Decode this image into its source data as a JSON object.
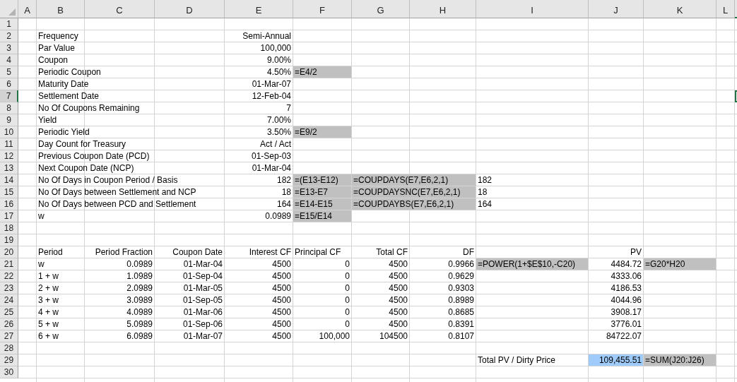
{
  "columns": [
    {
      "label": "A"
    },
    {
      "label": "B"
    },
    {
      "label": "C"
    },
    {
      "label": "D"
    },
    {
      "label": "E"
    },
    {
      "label": "F"
    },
    {
      "label": "G"
    },
    {
      "label": "H"
    },
    {
      "label": "I"
    },
    {
      "label": "J"
    },
    {
      "label": "K"
    },
    {
      "label": "L"
    }
  ],
  "rows": [
    {
      "number": "1",
      "selected": false
    },
    {
      "number": "2",
      "selected": false,
      "cells": {
        "B": {
          "kind": "label",
          "text": "Frequency"
        },
        "E": {
          "kind": "value",
          "text": "Semi-Annual"
        }
      }
    },
    {
      "number": "3",
      "selected": false,
      "cells": {
        "B": {
          "kind": "label",
          "text": "Par Value"
        },
        "E": {
          "kind": "value",
          "text": "100,000"
        }
      }
    },
    {
      "number": "4",
      "selected": false,
      "cells": {
        "B": {
          "kind": "label",
          "text": "Coupon"
        },
        "E": {
          "kind": "value",
          "text": "9.00%"
        }
      }
    },
    {
      "number": "5",
      "selected": false,
      "cells": {
        "B": {
          "kind": "label",
          "text": "Periodic Coupon"
        },
        "E": {
          "kind": "value",
          "text": "4.50%"
        },
        "F": {
          "kind": "formula",
          "text": "=E4/2"
        }
      }
    },
    {
      "number": "6",
      "selected": false,
      "cells": {
        "B": {
          "kind": "label",
          "text": "Maturity Date"
        },
        "E": {
          "kind": "value",
          "text": "01-Mar-07"
        }
      }
    },
    {
      "number": "7",
      "selected": true,
      "cells": {
        "B": {
          "kind": "label",
          "text": "Settlement Date"
        },
        "E": {
          "kind": "value",
          "text": "12-Feb-04"
        }
      }
    },
    {
      "number": "8",
      "selected": false,
      "cells": {
        "B": {
          "kind": "label",
          "text": "No Of Coupons Remaining"
        },
        "E": {
          "kind": "value",
          "text": "7"
        }
      }
    },
    {
      "number": "9",
      "selected": false,
      "cells": {
        "B": {
          "kind": "label",
          "text": "Yield"
        },
        "E": {
          "kind": "value",
          "text": "7.00%"
        }
      }
    },
    {
      "number": "10",
      "selected": false,
      "cells": {
        "B": {
          "kind": "label",
          "text": "Periodic Yield"
        },
        "E": {
          "kind": "value",
          "text": "3.50%"
        },
        "F": {
          "kind": "formula",
          "text": "=E9/2"
        }
      }
    },
    {
      "number": "11",
      "selected": false,
      "cells": {
        "B": {
          "kind": "label",
          "text": "Day Count for Treasury"
        },
        "E": {
          "kind": "value",
          "text": "Act / Act"
        }
      }
    },
    {
      "number": "12",
      "selected": false,
      "cells": {
        "B": {
          "kind": "label",
          "text": "Previous Coupon Date (PCD)"
        },
        "E": {
          "kind": "value",
          "text": "01-Sep-03"
        }
      }
    },
    {
      "number": "13",
      "selected": false,
      "cells": {
        "B": {
          "kind": "label",
          "text": "Next Coupon Date (NCP)"
        },
        "E": {
          "kind": "value",
          "text": "01-Mar-04"
        }
      }
    },
    {
      "number": "14",
      "selected": false,
      "cells": {
        "B": {
          "kind": "label",
          "text": "No Of Days in Coupon Period / Basis"
        },
        "E": {
          "kind": "value",
          "text": "182"
        },
        "F": {
          "kind": "formula",
          "text": "=(E13-E12)"
        },
        "G": {
          "kind": "formula-wide",
          "text": "=COUPDAYS(E7,E6,2,1)"
        },
        "I": {
          "kind": "label",
          "text": "182"
        }
      }
    },
    {
      "number": "15",
      "selected": false,
      "cells": {
        "B": {
          "kind": "label",
          "text": "No Of Days between Settlement and NCP"
        },
        "E": {
          "kind": "value",
          "text": "18"
        },
        "F": {
          "kind": "formula",
          "text": "=E13-E7"
        },
        "G": {
          "kind": "formula-wide",
          "text": "=COUPDAYSNC(E7,E6,2,1)"
        },
        "I": {
          "kind": "label",
          "text": "18"
        }
      }
    },
    {
      "number": "16",
      "selected": false,
      "cells": {
        "B": {
          "kind": "label",
          "text": "No Of Days between PCD and Settlement"
        },
        "E": {
          "kind": "value",
          "text": "164"
        },
        "F": {
          "kind": "formula",
          "text": "=E14-E15"
        },
        "G": {
          "kind": "formula-wide",
          "text": "=COUPDAYBS(E7,E6,2,1)"
        },
        "I": {
          "kind": "label",
          "text": "164"
        }
      }
    },
    {
      "number": "17",
      "selected": false,
      "cells": {
        "B": {
          "kind": "label",
          "text": "w"
        },
        "E": {
          "kind": "value",
          "text": "0.0989"
        },
        "F": {
          "kind": "formula",
          "text": "=E15/E14"
        }
      }
    },
    {
      "number": "18",
      "selected": false
    },
    {
      "number": "19",
      "selected": false
    },
    {
      "number": "20",
      "selected": false,
      "cells": {
        "B": {
          "kind": "label",
          "text": "Period"
        },
        "C": {
          "kind": "value",
          "text": "Period Fraction"
        },
        "D": {
          "kind": "value",
          "text": "Coupon Date"
        },
        "E": {
          "kind": "value",
          "text": "Interest CF"
        },
        "F": {
          "kind": "label",
          "text": "Principal CF"
        },
        "G": {
          "kind": "value",
          "text": "Total CF"
        },
        "H": {
          "kind": "value",
          "text": "DF"
        },
        "J": {
          "kind": "value",
          "text": "PV"
        }
      }
    },
    {
      "number": "21",
      "selected": false,
      "cells": {
        "B": {
          "kind": "label",
          "text": "w"
        },
        "C": {
          "kind": "value",
          "text": "0.0989"
        },
        "D": {
          "kind": "value",
          "text": "01-Mar-04"
        },
        "E": {
          "kind": "value",
          "text": "4500"
        },
        "F": {
          "kind": "value",
          "text": "0"
        },
        "G": {
          "kind": "value",
          "text": "4500"
        },
        "H": {
          "kind": "value",
          "text": "0.9966"
        },
        "I": {
          "kind": "formula",
          "text": "=POWER(1+$E$10,-C20)"
        },
        "J": {
          "kind": "value",
          "text": "4484.72"
        },
        "K": {
          "kind": "formula",
          "text": "=G20*H20"
        }
      }
    },
    {
      "number": "22",
      "selected": false,
      "cells": {
        "B": {
          "kind": "label",
          "text": "1 + w"
        },
        "C": {
          "kind": "value",
          "text": "1.0989"
        },
        "D": {
          "kind": "value",
          "text": "01-Sep-04"
        },
        "E": {
          "kind": "value",
          "text": "4500"
        },
        "F": {
          "kind": "value",
          "text": "0"
        },
        "G": {
          "kind": "value",
          "text": "4500"
        },
        "H": {
          "kind": "value",
          "text": "0.9629"
        },
        "J": {
          "kind": "value",
          "text": "4333.06"
        }
      }
    },
    {
      "number": "23",
      "selected": false,
      "cells": {
        "B": {
          "kind": "label",
          "text": "2 + w"
        },
        "C": {
          "kind": "value",
          "text": "2.0989"
        },
        "D": {
          "kind": "value",
          "text": "01-Mar-05"
        },
        "E": {
          "kind": "value",
          "text": "4500"
        },
        "F": {
          "kind": "value",
          "text": "0"
        },
        "G": {
          "kind": "value",
          "text": "4500"
        },
        "H": {
          "kind": "value",
          "text": "0.9303"
        },
        "J": {
          "kind": "value",
          "text": "4186.53"
        }
      }
    },
    {
      "number": "24",
      "selected": false,
      "cells": {
        "B": {
          "kind": "label",
          "text": "3 + w"
        },
        "C": {
          "kind": "value",
          "text": "3.0989"
        },
        "D": {
          "kind": "value",
          "text": "01-Sep-05"
        },
        "E": {
          "kind": "value",
          "text": "4500"
        },
        "F": {
          "kind": "value",
          "text": "0"
        },
        "G": {
          "kind": "value",
          "text": "4500"
        },
        "H": {
          "kind": "value",
          "text": "0.8989"
        },
        "J": {
          "kind": "value",
          "text": "4044.96"
        }
      }
    },
    {
      "number": "25",
      "selected": false,
      "cells": {
        "B": {
          "kind": "label",
          "text": "4 + w"
        },
        "C": {
          "kind": "value",
          "text": "4.0989"
        },
        "D": {
          "kind": "value",
          "text": "01-Mar-06"
        },
        "E": {
          "kind": "value",
          "text": "4500"
        },
        "F": {
          "kind": "value",
          "text": "0"
        },
        "G": {
          "kind": "value",
          "text": "4500"
        },
        "H": {
          "kind": "value",
          "text": "0.8685"
        },
        "J": {
          "kind": "value",
          "text": "3908.17"
        }
      }
    },
    {
      "number": "26",
      "selected": false,
      "cells": {
        "B": {
          "kind": "label",
          "text": "5 + w"
        },
        "C": {
          "kind": "value",
          "text": "5.0989"
        },
        "D": {
          "kind": "value",
          "text": "01-Sep-06"
        },
        "E": {
          "kind": "value",
          "text": "4500"
        },
        "F": {
          "kind": "value",
          "text": "0"
        },
        "G": {
          "kind": "value",
          "text": "4500"
        },
        "H": {
          "kind": "value",
          "text": "0.8391"
        },
        "J": {
          "kind": "value",
          "text": "3776.01"
        }
      }
    },
    {
      "number": "27",
      "selected": false,
      "cells": {
        "B": {
          "kind": "label",
          "text": "6 + w"
        },
        "C": {
          "kind": "value",
          "text": "6.0989"
        },
        "D": {
          "kind": "value",
          "text": "01-Mar-07"
        },
        "E": {
          "kind": "value",
          "text": "4500"
        },
        "F": {
          "kind": "value",
          "text": "100,000"
        },
        "G": {
          "kind": "value",
          "text": "104500"
        },
        "H": {
          "kind": "value",
          "text": "0.8107"
        },
        "J": {
          "kind": "value",
          "text": "84722.07"
        }
      }
    },
    {
      "number": "28",
      "selected": false
    },
    {
      "number": "29",
      "selected": false,
      "cells": {
        "I": {
          "kind": "label",
          "text": "Total PV / Dirty Price"
        },
        "J": {
          "kind": "highlighted",
          "text": "109,455.51"
        },
        "K": {
          "kind": "formula",
          "text": "=SUM(J20:J26)"
        }
      }
    },
    {
      "number": "30",
      "selected": false
    }
  ]
}
